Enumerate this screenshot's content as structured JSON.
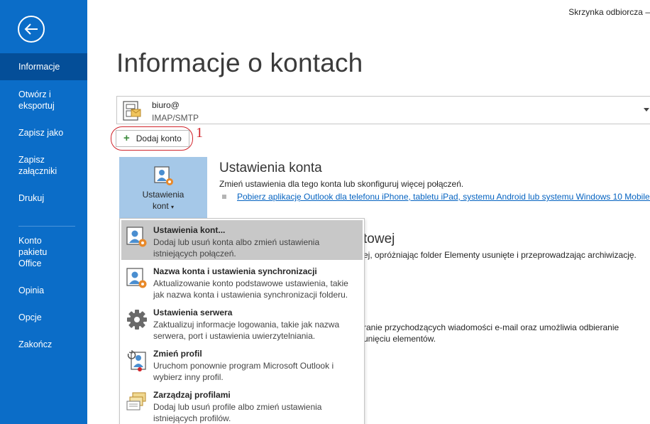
{
  "window": {
    "title": "Skrzynka odbiorcza – "
  },
  "sidebar": {
    "items": [
      {
        "label": "Informacje"
      },
      {
        "label": "Otwórz i eksportuj"
      },
      {
        "label": "Zapisz jako"
      },
      {
        "label": "Zapisz załączniki"
      },
      {
        "label": "Drukuj"
      },
      {
        "label": "Konto pakietu Office"
      },
      {
        "label": "Opinia"
      },
      {
        "label": "Opcje"
      },
      {
        "label": "Zakończ"
      }
    ]
  },
  "main": {
    "title": "Informacje o kontach",
    "account": {
      "email": "biuro@",
      "type": "IMAP/SMTP"
    },
    "add_account": {
      "label": "Dodaj konto",
      "marker": "1"
    },
    "account_settings": {
      "button_label_line1": "Ustawienia",
      "button_label_line2": "kont",
      "title": "Ustawienia konta",
      "description": "Zmień ustawienia dla tego konta lub skonfiguruj więcej połączeń.",
      "link": "Pobierz aplikację Outlook dla telefonu iPhone, tabletu iPad, systemu Android lub systemu Windows 10 Mobile."
    },
    "background": {
      "title_fragment": "towej",
      "line1": "ej, opróżniając folder Elementy usunięte i przeprowadzając archiwizację.",
      "line2": "ranie przychodzących wiadomości e-mail oraz umożliwia odbieranie",
      "line3": "unięciu elementów."
    }
  },
  "menu": {
    "items": [
      {
        "title": "Ustawienia kont...",
        "desc": "Dodaj lub usuń konta albo zmień ustawienia istniejących połączeń.",
        "icon": "account-settings-icon"
      },
      {
        "title": "Nazwa konta i ustawienia synchronizacji",
        "desc": "Aktualizowanie konto podstawowe ustawienia, takie jak nazwa konta i ustawienia synchronizacji folderu.",
        "icon": "account-sync-icon"
      },
      {
        "title": "Ustawienia serwera",
        "desc": "Zaktualizuj informacje logowania, takie jak nazwa serwera, port i ustawienia uwierzytelniania.",
        "icon": "gear-icon"
      },
      {
        "title": "Zmień profil",
        "desc": "Uruchom ponownie program Microsoft Outlook i wybierz inny profil.",
        "icon": "change-profile-icon"
      },
      {
        "title": "Zarządzaj profilami",
        "desc": "Dodaj lub usuń profile albo zmień ustawienia istniejących profilów.",
        "icon": "manage-profiles-icon"
      }
    ]
  },
  "colors": {
    "sidebar": "#0b6dc8",
    "sidebar_active": "#044e98",
    "link": "#0563c1",
    "highlight": "#d0232a",
    "button": "#a5c8e8"
  }
}
